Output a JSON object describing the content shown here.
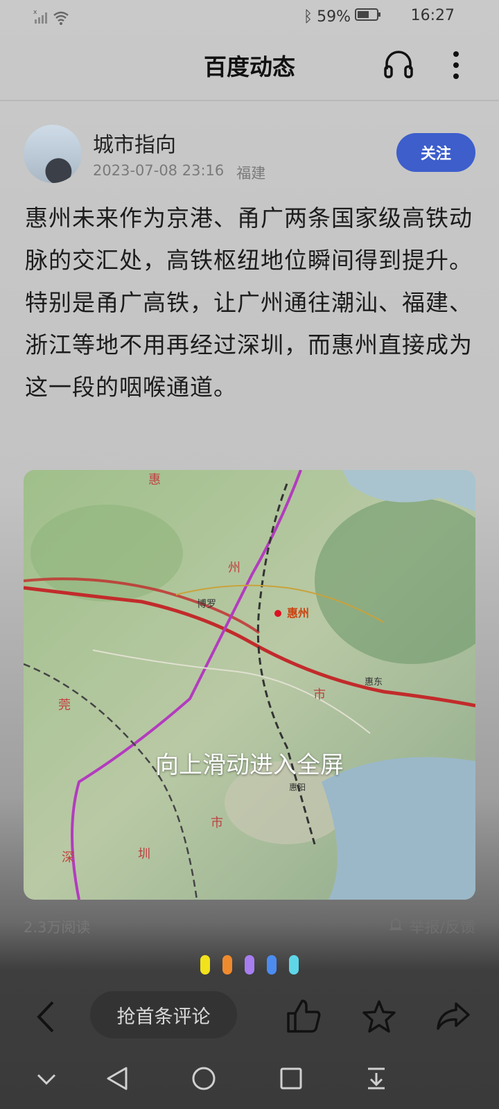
{
  "status_bar": {
    "battery": "59%",
    "time": "16:27"
  },
  "header": {
    "title": "百度动态"
  },
  "post": {
    "author": "城市指向",
    "date": "2023-07-08 23:16",
    "location": "福建",
    "follow_label": "关注",
    "text": "惠州未来作为京港、甬广两条国家级高铁动脉的交汇处，高铁枢纽地位瞬间得到提升。特别是甬广高铁，让广州通往潮汕、福建、浙江等地不用再经过深圳，而惠州直接成为这一段的咽喉通道。",
    "overlay_hint": "向上滑动进入全屏",
    "read_count": "2.3万阅读",
    "report_label": "举报/反馈",
    "map_labels": {
      "hui": "惠",
      "zhou": "州",
      "shi": "市",
      "shi2": "市",
      "huizhou": "惠州",
      "boluo": "博罗",
      "huidong": "惠东",
      "huiyang": "惠阳",
      "shen": "深",
      "zhen": "圳",
      "guan": "莞"
    }
  },
  "page_dots": [
    "#f2e21c",
    "#f08a2e",
    "#a77df0",
    "#4c8cf0",
    "#5fd6e8"
  ],
  "bottom_bar": {
    "comment_placeholder": "抢首条评论"
  }
}
